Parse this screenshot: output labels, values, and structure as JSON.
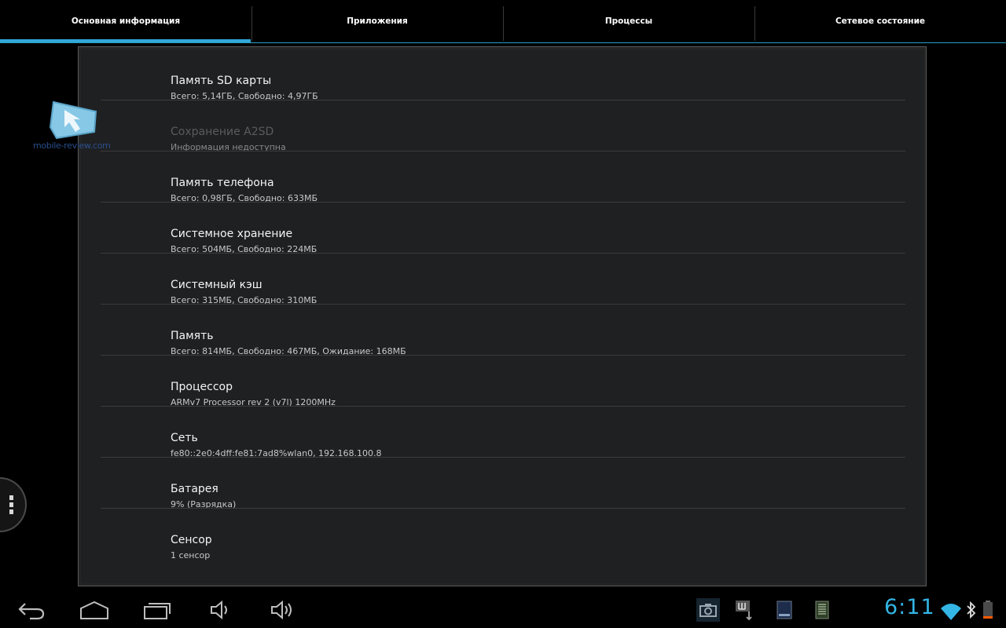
{
  "tabs": [
    {
      "label": "Основная информация",
      "selected": true
    },
    {
      "label": "Приложения",
      "selected": false
    },
    {
      "label": "Процессы",
      "selected": false
    },
    {
      "label": "Сетевое состояние",
      "selected": false
    }
  ],
  "items": [
    {
      "title": "Память SD карты",
      "subtitle": "Всего: 5,14ГБ, Свободно: 4,97ГБ",
      "enabled": true
    },
    {
      "title": "Сохранение A2SD",
      "subtitle": "Информация недоступна",
      "enabled": false
    },
    {
      "title": "Память телефона",
      "subtitle": "Всего: 0,98ГБ, Свободно: 633МБ",
      "enabled": true
    },
    {
      "title": "Системное хранение",
      "subtitle": "Всего: 504МБ, Свободно: 224МБ",
      "enabled": true
    },
    {
      "title": "Системный кэш",
      "subtitle": "Всего: 315МБ, Свободно: 310МБ",
      "enabled": true
    },
    {
      "title": "Память",
      "subtitle": "Всего: 814МБ, Свободно: 467МБ, Ожидание: 168МБ",
      "enabled": true
    },
    {
      "title": "Процессор",
      "subtitle": "ARMv7 Processor rev 2 (v7l)  1200MHz",
      "enabled": true
    },
    {
      "title": "Сеть",
      "subtitle": "fe80::2e0:4dff:fe81:7ad8%wlan0, 192.168.100.8",
      "enabled": true
    },
    {
      "title": "Батарея",
      "subtitle": "9% (Разрядка)",
      "enabled": true
    },
    {
      "title": "Сенсор",
      "subtitle": "1 сенсор",
      "enabled": true
    }
  ],
  "watermark": {
    "text": "mobile-review.com"
  },
  "status": {
    "clock": "6:11",
    "battery_level": 0.09
  },
  "colors": {
    "accent": "#33b5e5",
    "background": "#000000",
    "panel": "#1f2022"
  },
  "icons": {
    "nav": [
      "back-icon",
      "home-icon",
      "recent-apps-icon",
      "volume-down-icon",
      "volume-up-icon"
    ],
    "status": [
      "screenshot-icon",
      "usb-debugging-icon",
      "sd-card-icon",
      "notification-icon",
      "wifi-icon",
      "bluetooth-icon",
      "battery-icon"
    ],
    "menu": "overflow-menu-icon"
  }
}
